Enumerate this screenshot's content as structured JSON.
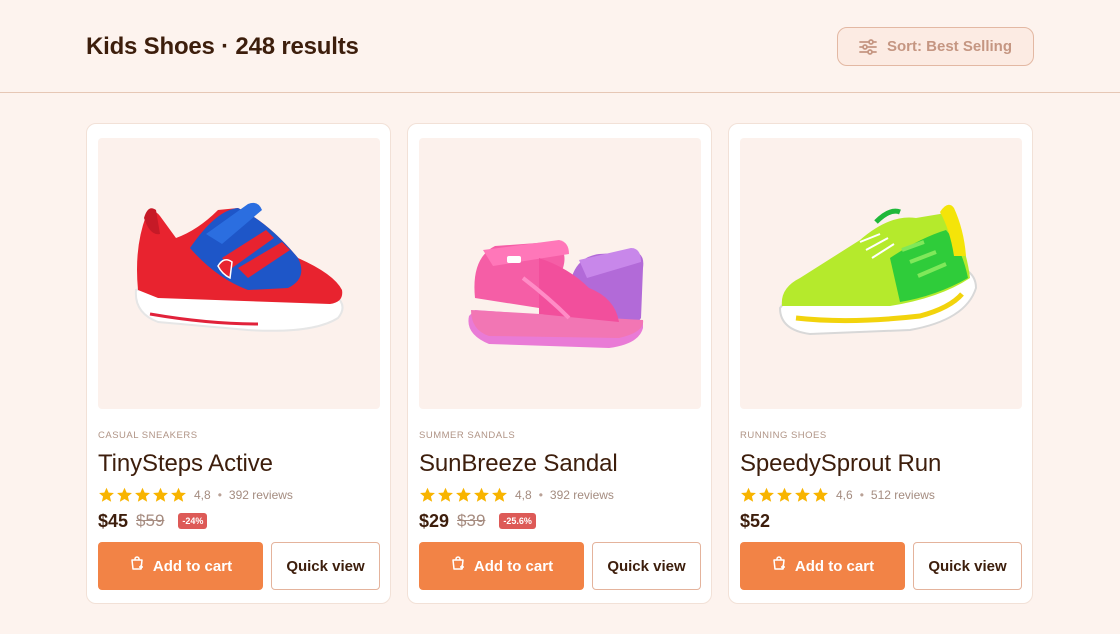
{
  "header": {
    "title": "Kids Shoes · 248 results",
    "sort_label": "Sort: Best Selling",
    "sort_icon": "sliders-icon"
  },
  "colors": {
    "accent": "#f28346",
    "background": "#fdf3ee",
    "discount": "#dd5a57",
    "star": "#f8b400"
  },
  "products": [
    {
      "category": "CASUAL SNEAKERS",
      "name": "TinySteps Active",
      "rating": "4,8",
      "reviews": "392 reviews",
      "stars": 5,
      "price": "$45",
      "old_price": "$59",
      "discount": "-24%",
      "add_label": "Add to cart",
      "quick_label": "Quick view"
    },
    {
      "category": "SUMMER SANDALS",
      "name": "SunBreeze Sandal",
      "rating": "4,8",
      "reviews": "392 reviews",
      "stars": 5,
      "price": "$29",
      "old_price": "$39",
      "discount": "-25.6%",
      "add_label": "Add to cart",
      "quick_label": "Quick view"
    },
    {
      "category": "RUNNING SHOES",
      "name": "SpeedySprout Run",
      "rating": "4,6",
      "reviews": "512 reviews",
      "stars": 5,
      "price": "$52",
      "add_label": "Add to cart",
      "quick_label": "Quick view"
    }
  ]
}
